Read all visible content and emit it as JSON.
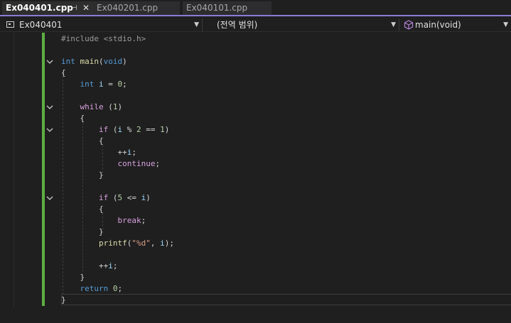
{
  "tabs": [
    {
      "label": "Ex040401.cpp",
      "active": true
    },
    {
      "label": "Ex040201.cpp",
      "active": false
    },
    {
      "label": "Ex040101.cpp",
      "active": false
    }
  ],
  "pin_icon": "⊣",
  "close_icon": "✕",
  "nav": {
    "project": "Ex040401",
    "scope": "(전역 범위)",
    "member": "main(void)"
  },
  "code_lines": [
    "#include <stdio.h>",
    "",
    "int main(void)",
    "{",
    "    int i = 0;",
    "",
    "    while (1)",
    "    {",
    "        if (i % 2 == 1)",
    "        {",
    "            ++i;",
    "            continue;",
    "        }",
    "",
    "        if (5 <= i)",
    "        {",
    "            break;",
    "        }",
    "        printf(\"%d\", i);",
    "",
    "        ++i;",
    "    }",
    "    return 0;",
    "}"
  ],
  "colors": {
    "accent": "#8a7bd8",
    "change_bar": "#5fad44",
    "keyword": "#569cd6",
    "control_keyword": "#d8a0df",
    "string": "#d69d85"
  }
}
